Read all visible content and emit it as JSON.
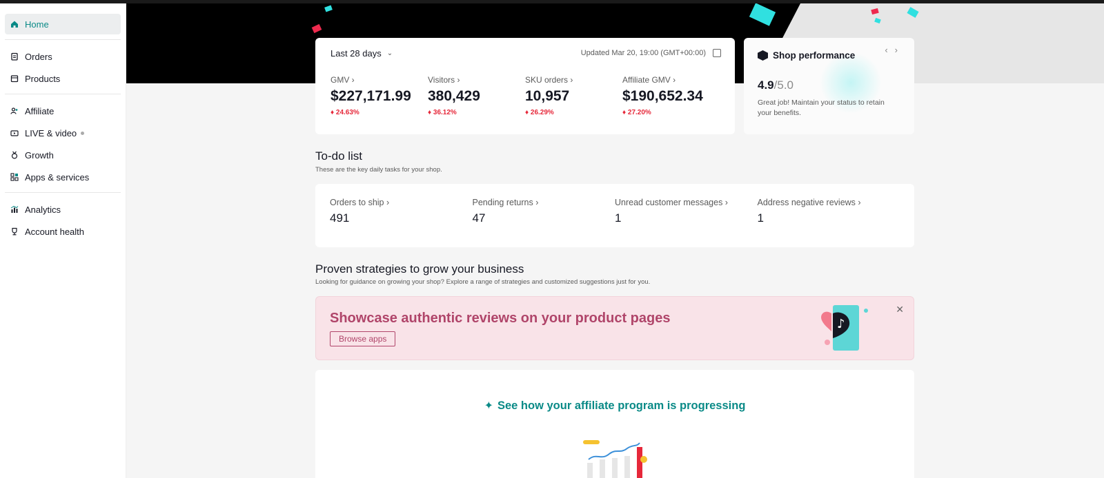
{
  "sidebar": {
    "items": [
      {
        "label": "Home",
        "icon": "home-icon",
        "active": true
      },
      {
        "label": "Orders",
        "icon": "clipboard-icon"
      },
      {
        "label": "Products",
        "icon": "box-icon"
      },
      {
        "label": "Affiliate",
        "icon": "users-icon"
      },
      {
        "label": "LIVE & video",
        "icon": "video-icon"
      },
      {
        "label": "Growth",
        "icon": "medal-icon"
      },
      {
        "label": "Apps & services",
        "icon": "apps-grid-icon"
      },
      {
        "label": "Analytics",
        "icon": "chart-icon"
      },
      {
        "label": "Account health",
        "icon": "trophy-icon"
      }
    ]
  },
  "metrics": {
    "range": "Last 28 days",
    "updated": "Updated Mar 20, 19:00 (GMT+00:00)",
    "items": [
      {
        "label": "GMV",
        "value": "$227,171.99",
        "change": "24.63%"
      },
      {
        "label": "Visitors",
        "value": "380,429",
        "change": "36.12%"
      },
      {
        "label": "SKU orders",
        "value": "10,957",
        "change": "26.29%"
      },
      {
        "label": "Affiliate GMV",
        "value": "$190,652.34",
        "change": "27.20%"
      }
    ]
  },
  "performance": {
    "title": "Shop performance",
    "score": "4.9",
    "max": "/5.0",
    "desc": "Great job! Maintain your status to retain your benefits."
  },
  "todo": {
    "title": "To-do list",
    "subtitle": "These are the key daily tasks for your shop.",
    "items": [
      {
        "label": "Orders to ship",
        "value": "491"
      },
      {
        "label": "Pending returns",
        "value": "47"
      },
      {
        "label": "Unread customer messages",
        "value": "1"
      },
      {
        "label": "Address negative reviews",
        "value": "1"
      }
    ]
  },
  "strategies": {
    "title": "Proven strategies to grow your business",
    "subtitle": "Looking for guidance on growing your shop? Explore a range of strategies and customized suggestions just for you."
  },
  "banner": {
    "title": "Showcase authentic reviews on your product pages",
    "button": "Browse apps"
  },
  "affiliate": {
    "title": "See how your affiliate program is progressing"
  },
  "colors": {
    "accent": "#0a8a87",
    "negative": "#e6283a",
    "banner_text": "#b0456a"
  }
}
